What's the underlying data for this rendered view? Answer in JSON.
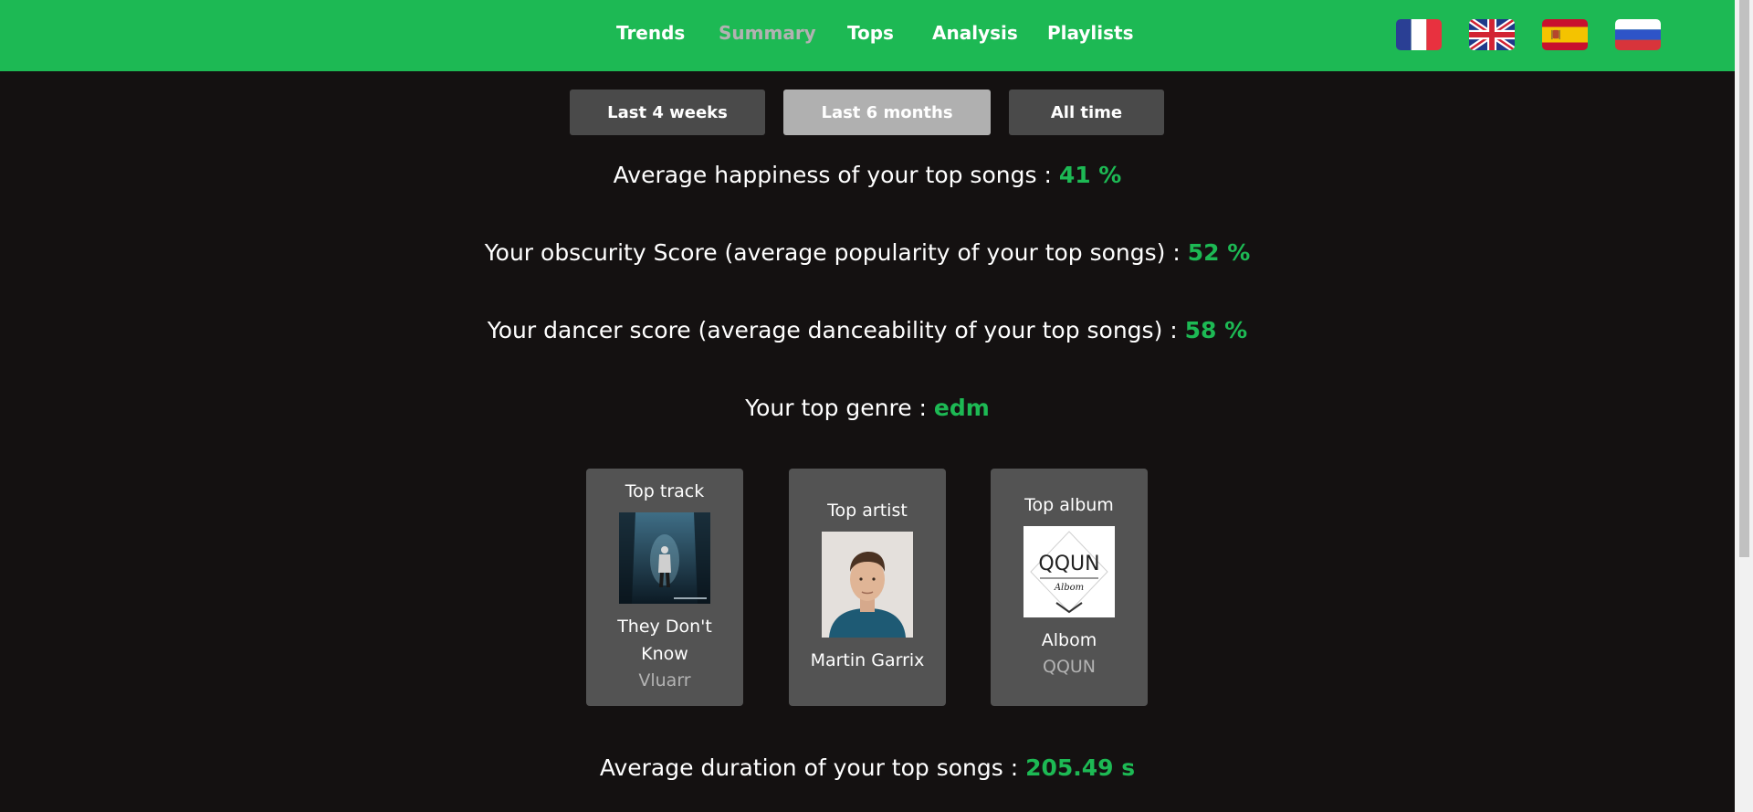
{
  "nav": {
    "links": [
      "Trends",
      "Summary",
      "Tops",
      "Analysis",
      "Playlists"
    ],
    "active": "Summary"
  },
  "flags": [
    {
      "name": "france-flag-icon",
      "lang": "French"
    },
    {
      "name": "uk-flag-icon",
      "lang": "English"
    },
    {
      "name": "spain-flag-icon",
      "lang": "Spanish"
    },
    {
      "name": "russia-flag-icon",
      "lang": "Russian"
    }
  ],
  "ranges": {
    "short": "Last 4 weeks",
    "medium": "Last 6 months",
    "long": "All time",
    "selected": "medium"
  },
  "stats": {
    "happiness": {
      "label": "Average happiness of your top songs : ",
      "value": "41 %"
    },
    "obscurity": {
      "label": "Your obscurity Score (average popularity of your top songs) : ",
      "value": "52 %"
    },
    "dancer": {
      "label": "Your dancer score (average danceability of your top songs) : ",
      "value": "58 %"
    },
    "genre": {
      "label": "Your top genre : ",
      "value": "edm"
    },
    "duration": {
      "label": "Average duration of your top songs : ",
      "value": "205.49 s"
    }
  },
  "cards": {
    "track": {
      "title": "Top track",
      "name": "They Don't Know",
      "sub": "Vluarr",
      "image": "track-cover-image"
    },
    "artist": {
      "title": "Top artist",
      "name": "Martin Garrix",
      "image": "artist-photo"
    },
    "album": {
      "title": "Top album",
      "name": "Albom",
      "sub": "QQUN",
      "image": "album-cover-image",
      "cover_text": "QQUN",
      "cover_subtext": "Albom"
    }
  },
  "colors": {
    "accent": "#1db954",
    "background": "#141111",
    "card": "#535353",
    "button": "#4a4a4a",
    "button_active": "#b0b0b0"
  }
}
